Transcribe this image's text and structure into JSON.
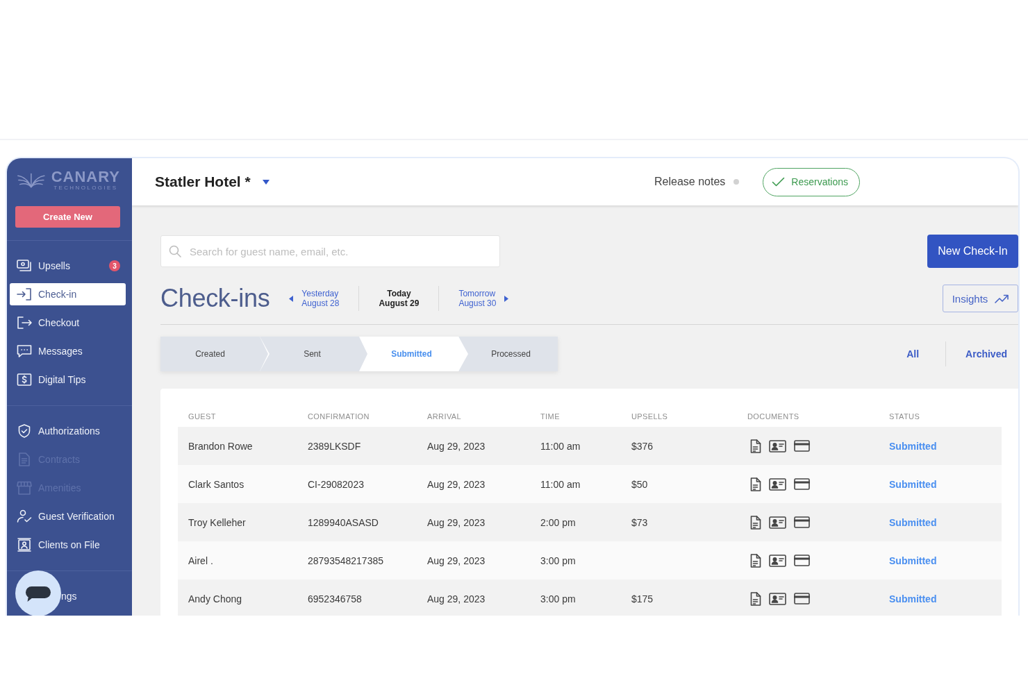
{
  "sidebar": {
    "logo": {
      "name": "CANARY",
      "tagline": "TECHNOLOGIES"
    },
    "create_button": "Create New",
    "sections": [
      {
        "items": [
          {
            "label": "Upsells",
            "badge": "3",
            "selected": false,
            "disabled": false
          },
          {
            "label": "Check-in",
            "selected": true,
            "disabled": false
          },
          {
            "label": "Checkout",
            "selected": false,
            "disabled": false
          },
          {
            "label": "Messages",
            "selected": false,
            "disabled": false
          },
          {
            "label": "Digital Tips",
            "selected": false,
            "disabled": false
          }
        ]
      },
      {
        "items": [
          {
            "label": "Authorizations",
            "selected": false,
            "disabled": false
          },
          {
            "label": "Contracts",
            "selected": false,
            "disabled": true
          },
          {
            "label": "Amenities",
            "selected": false,
            "disabled": true
          },
          {
            "label": "Guest Verification",
            "selected": false,
            "disabled": false
          },
          {
            "label": "Clients on File",
            "selected": false,
            "disabled": false
          }
        ]
      },
      {
        "items": [
          {
            "label": "ngs",
            "selected": false,
            "disabled": false
          }
        ]
      }
    ]
  },
  "header": {
    "property": "Statler Hotel *",
    "release_notes": "Release notes",
    "reservations_button": "Reservations"
  },
  "search": {
    "placeholder": "Search for guest name, email, etc."
  },
  "new_checkin_button": "New Check-In",
  "page_title": "Check-ins",
  "date_nav": {
    "days": [
      {
        "label": "Yesterday",
        "date": "August 28",
        "selected": false
      },
      {
        "label": "Today",
        "date": "August 29",
        "selected": true
      },
      {
        "label": "Tomorrow",
        "date": "August 30",
        "selected": false
      }
    ]
  },
  "insights_button": "Insights",
  "stepper": {
    "steps": [
      {
        "label": "Created",
        "selected": false
      },
      {
        "label": "Sent",
        "selected": false
      },
      {
        "label": "Submitted",
        "selected": true
      },
      {
        "label": "Processed",
        "selected": false
      }
    ]
  },
  "filters": [
    "All",
    "Archived"
  ],
  "table": {
    "columns": [
      "GUEST",
      "CONFIRMATION",
      "ARRIVAL",
      "TIME",
      "UPSELLS",
      "DOCUMENTS",
      "STATUS"
    ],
    "rows": [
      {
        "guest": "Brandon Rowe",
        "confirmation": "2389LKSDF",
        "arrival": "Aug 29, 2023",
        "time": "11:00 am",
        "upsells": "$376",
        "status": "Submitted"
      },
      {
        "guest": "Clark Santos",
        "confirmation": "CI-29082023",
        "arrival": "Aug 29, 2023",
        "time": "11:00 am",
        "upsells": "$50",
        "status": "Submitted"
      },
      {
        "guest": "Troy Kelleher",
        "confirmation": "1289940ASASD",
        "arrival": "Aug 29, 2023",
        "time": "2:00 pm",
        "upsells": "$73",
        "status": "Submitted"
      },
      {
        "guest": "Airel .",
        "confirmation": "28793548217385",
        "arrival": "Aug 29, 2023",
        "time": "3:00 pm",
        "status": "Submitted"
      },
      {
        "guest": "Andy Chong",
        "confirmation": "6952346758",
        "arrival": "Aug 29, 2023",
        "time": "3:00 pm",
        "upsells": "$175",
        "status": "Submitted"
      }
    ]
  }
}
